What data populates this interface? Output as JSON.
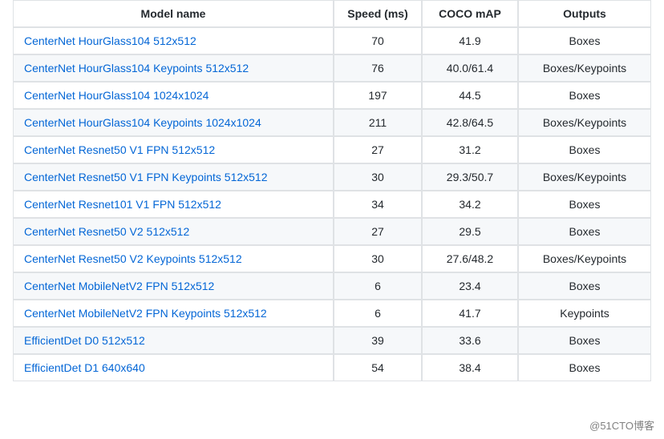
{
  "headers": {
    "model": "Model name",
    "speed": "Speed (ms)",
    "map": "COCO mAP",
    "outputs": "Outputs"
  },
  "rows": [
    {
      "model": "CenterNet HourGlass104 512x512",
      "speed": "70",
      "map": "41.9",
      "outputs": "Boxes"
    },
    {
      "model": "CenterNet HourGlass104 Keypoints 512x512",
      "speed": "76",
      "map": "40.0/61.4",
      "outputs": "Boxes/Keypoints"
    },
    {
      "model": "CenterNet HourGlass104 1024x1024",
      "speed": "197",
      "map": "44.5",
      "outputs": "Boxes"
    },
    {
      "model": "CenterNet HourGlass104 Keypoints 1024x1024",
      "speed": "211",
      "map": "42.8/64.5",
      "outputs": "Boxes/Keypoints"
    },
    {
      "model": "CenterNet Resnet50 V1 FPN 512x512",
      "speed": "27",
      "map": "31.2",
      "outputs": "Boxes"
    },
    {
      "model": "CenterNet Resnet50 V1 FPN Keypoints 512x512",
      "speed": "30",
      "map": "29.3/50.7",
      "outputs": "Boxes/Keypoints"
    },
    {
      "model": "CenterNet Resnet101 V1 FPN 512x512",
      "speed": "34",
      "map": "34.2",
      "outputs": "Boxes"
    },
    {
      "model": "CenterNet Resnet50 V2 512x512",
      "speed": "27",
      "map": "29.5",
      "outputs": "Boxes"
    },
    {
      "model": "CenterNet Resnet50 V2 Keypoints 512x512",
      "speed": "30",
      "map": "27.6/48.2",
      "outputs": "Boxes/Keypoints"
    },
    {
      "model": "CenterNet MobileNetV2 FPN 512x512",
      "speed": "6",
      "map": "23.4",
      "outputs": "Boxes"
    },
    {
      "model": "CenterNet MobileNetV2 FPN Keypoints 512x512",
      "speed": "6",
      "map": "41.7",
      "outputs": "Keypoints"
    },
    {
      "model": "EfficientDet D0 512x512",
      "speed": "39",
      "map": "33.6",
      "outputs": "Boxes"
    },
    {
      "model": "EfficientDet D1 640x640",
      "speed": "54",
      "map": "38.4",
      "outputs": "Boxes"
    }
  ],
  "watermark": "@51CTO博客"
}
